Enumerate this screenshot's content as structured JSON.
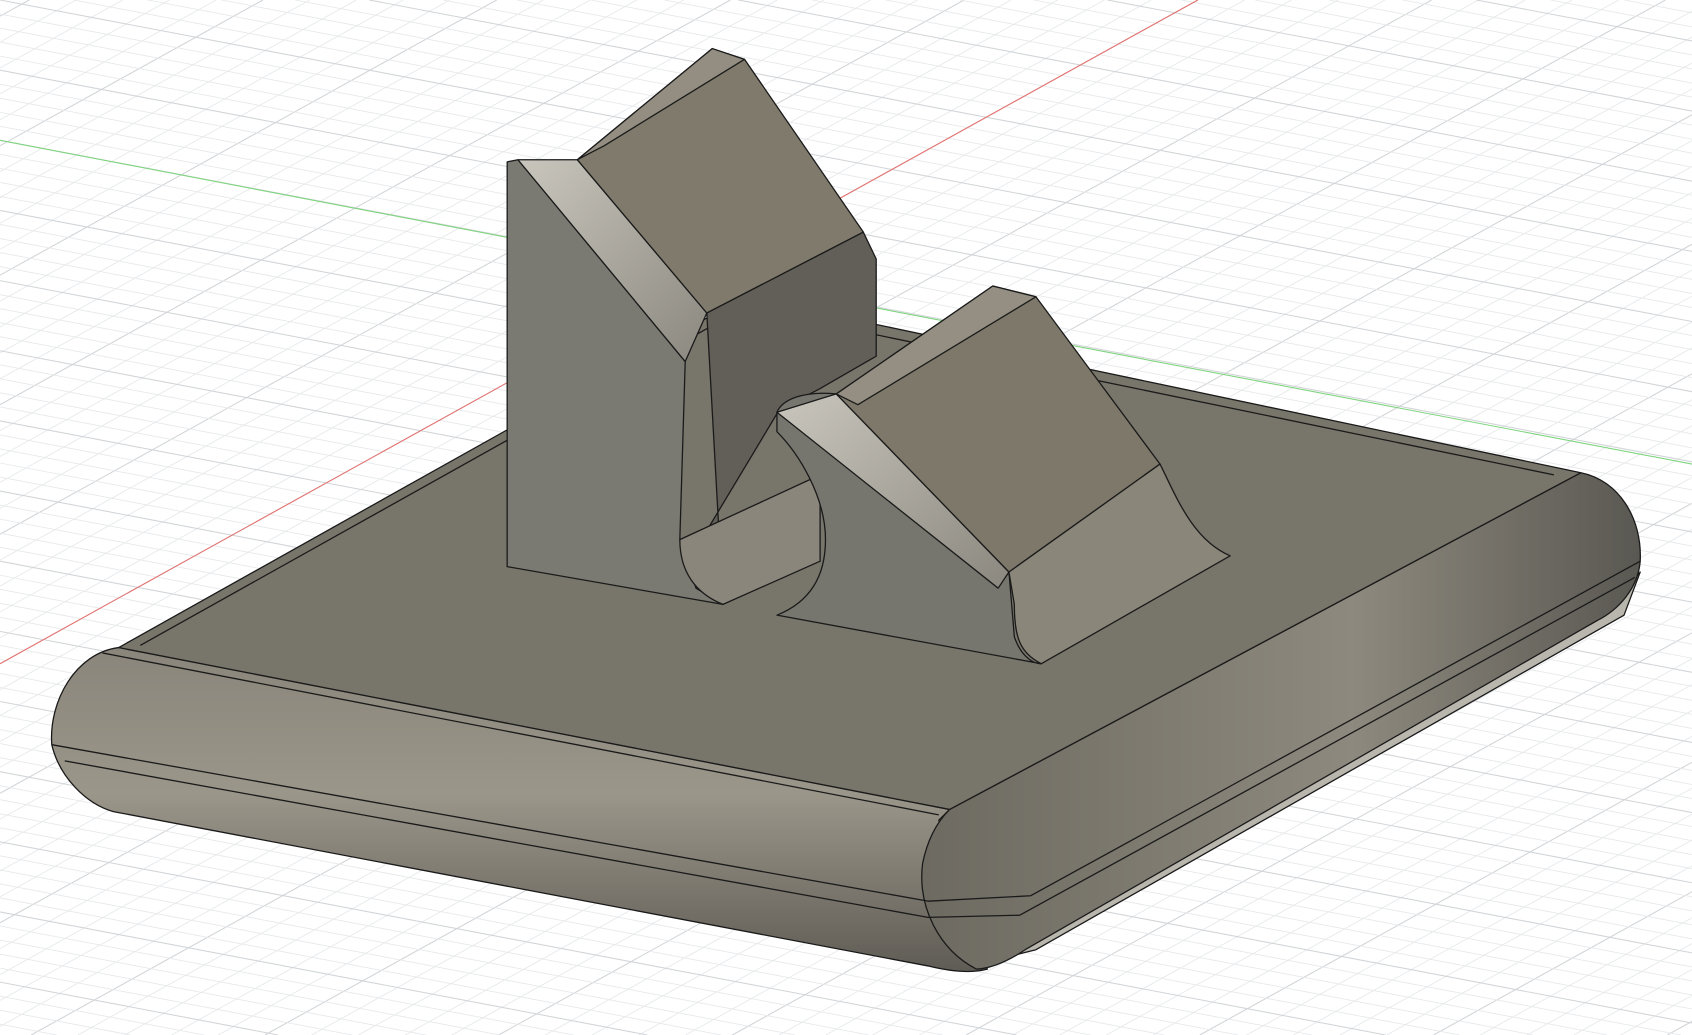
{
  "viewport": {
    "background": "#ffffff",
    "grid_minor_color": "#e6e8ea",
    "grid_major_color": "#d2d5d8",
    "axis_x_color": "#e4716f",
    "axis_y_color": "#7fd47f",
    "body_top_color": "#78756a",
    "body_side_color": "#6c695f",
    "body_light_color": "#a9a69c",
    "body_dark_color": "#5e5c55",
    "edge_color": "#1a1a1a"
  }
}
